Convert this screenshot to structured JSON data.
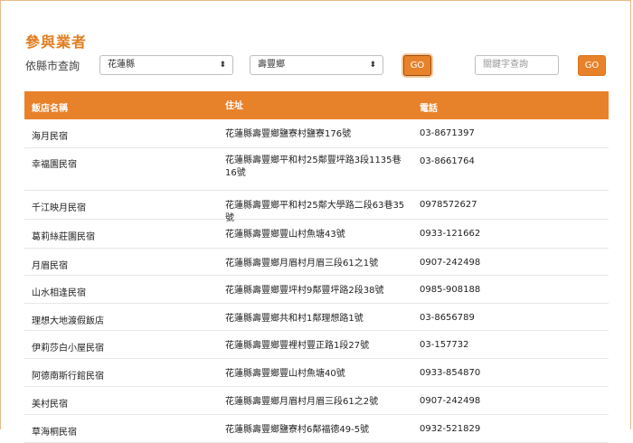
{
  "page": {
    "title": "參與業者",
    "filter_label": "依縣市查詢",
    "county_select": "花蓮縣",
    "township_select": "壽豐鄉",
    "go_button_1": "GO",
    "keyword_placeholder": "關鍵字查詢",
    "go_button_2": "GO"
  },
  "table": {
    "headers": [
      "飯店名稱",
      "住址",
      "電話"
    ],
    "rows": [
      {
        "name": "海月民宿",
        "address": "花蓮縣壽豐鄉鹽寮村鹽寮176號",
        "phone": "03-8671397"
      },
      {
        "name": "幸福園民宿",
        "address": "花蓮縣壽豐鄉平和村25鄰豐坪路3段1135巷16號",
        "phone": "03-8661764"
      },
      {
        "name": "千江映月民宿",
        "address": "花蓮縣壽豐鄉平和村25鄰大學路二段63巷35號",
        "phone": "0978572627"
      },
      {
        "name": "葛莉絲莊園民宿",
        "address": "花蓮縣壽豐鄉豐山村魚塘43號",
        "phone": "0933-121662"
      },
      {
        "name": "月眉民宿",
        "address": "花蓮縣壽豐鄉月眉村月眉三段61之1號",
        "phone": "0907-242498"
      },
      {
        "name": "山水相逢民宿",
        "address": "花蓮縣壽豐鄉豐坪村9鄰豐坪路2段38號",
        "phone": "0985-908188"
      },
      {
        "name": "理想大地渡假飯店",
        "address": "花蓮縣壽豐鄉共和村1鄰理想路1號",
        "phone": "03-8656789"
      },
      {
        "name": "伊莉莎白小屋民宿",
        "address": "花蓮縣壽豐鄉豐裡村豐正路1段27號",
        "phone": "03-157732"
      },
      {
        "name": "阿德南斯行館民宿",
        "address": "花蓮縣壽豐鄉豐山村魚塘40號",
        "phone": "0933-854870"
      },
      {
        "name": "美村民宿",
        "address": "花蓮縣壽豐鄉月眉村月眉三段61之2號",
        "phone": "0907-242498"
      },
      {
        "name": "草海桐民宿",
        "address": "花蓮縣壽豐鄉鹽寮村6鄰福德49-5號",
        "phone": "0932-521829"
      }
    ]
  }
}
